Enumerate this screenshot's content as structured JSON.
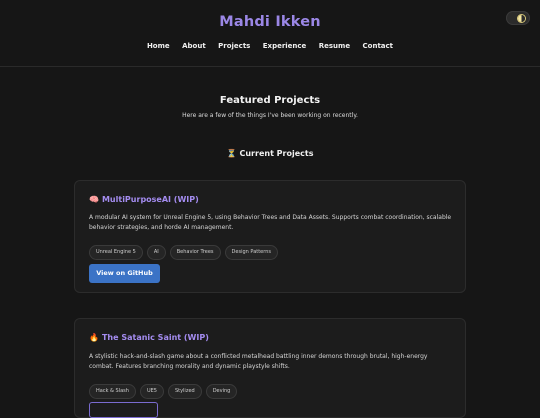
{
  "header": {
    "site_title": "Mahdi Ikken",
    "nav": [
      "Home",
      "About",
      "Projects",
      "Experience",
      "Resume",
      "Contact"
    ],
    "theme_toggle_icon": "half-moon-icon"
  },
  "main": {
    "section_title": "Featured Projects",
    "section_subtitle": "Here are a few of the things I've been working on recently.",
    "current_icon": "⏳",
    "current_label": "Current Projects",
    "projects": [
      {
        "emoji": "🧠",
        "title": "MultiPurposeAI (WIP)",
        "description": "A modular AI system for Unreal Engine 5, using Behavior Trees and Data Assets. Supports combat coordination, scalable behavior strategies, and horde AI management.",
        "tags": [
          "Unreal Engine 5",
          "AI",
          "Behavior Trees",
          "Design Patterns"
        ],
        "button": "View on GitHub"
      },
      {
        "emoji": "🔥",
        "title": "The Satanic Saint (WIP)",
        "description": "A stylistic hack-and-slash game about a conflicted metalhead battling inner demons through brutal, high-energy combat. Features branching morality and dynamic playstyle shifts.",
        "tags": [
          "Hack & Slash",
          "UE5",
          "Stylized",
          "Deving"
        ],
        "button": ""
      }
    ]
  },
  "colors": {
    "accent": "#9b87e6",
    "background": "#161616",
    "card": "#1c1c1c",
    "button": "#3b73c6"
  }
}
